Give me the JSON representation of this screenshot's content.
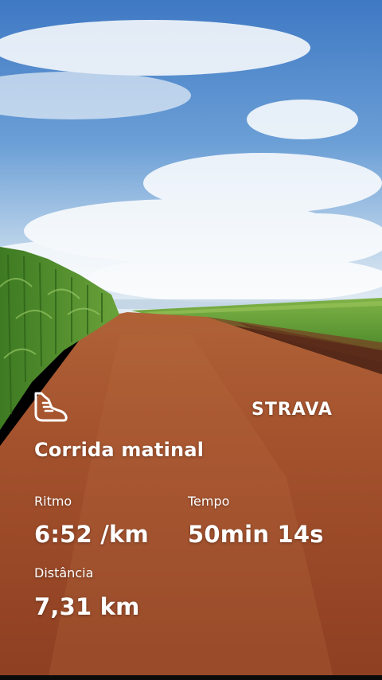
{
  "activity": {
    "title": "Corrida matinal",
    "brand": "STRAVA",
    "icon": "running-shoe-icon"
  },
  "stats": {
    "pace": {
      "label": "Ritmo",
      "value": "6:52 /km"
    },
    "time": {
      "label": "Tempo",
      "value": "50min 14s"
    },
    "distance": {
      "label": "Distância",
      "value": "7,31 km"
    }
  },
  "colors": {
    "sky": "#4f86c6",
    "dirt_road": "#a5502c",
    "cornfield": "#4f8a2a",
    "text": "#ffffff"
  }
}
